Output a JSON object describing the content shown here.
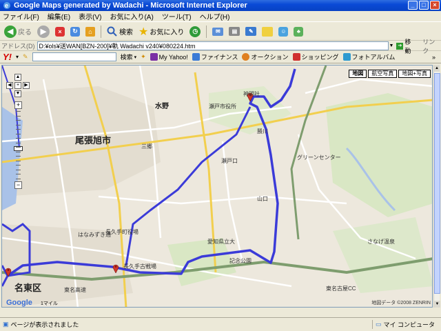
{
  "window": {
    "title": "Google Maps generated by Wadachi - Microsoft Internet Explorer",
    "minimize": "_",
    "maximize": "□",
    "close": "×"
  },
  "menu": [
    "ファイル(F)",
    "編集(E)",
    "表示(V)",
    "お気に入り(A)",
    "ツール(T)",
    "ヘルプ(H)"
  ],
  "toolbar": {
    "back_label": "戻る",
    "search_label": "検索",
    "favorites_label": "お気に入り"
  },
  "address": {
    "label": "アドレス(D)",
    "value": "D:¥ols¥送WAN[BZN-200]¥軌 Wadachi v240¥080224.htm",
    "go_label": "移動",
    "links_label": "リンク"
  },
  "yahoo": {
    "logo": "Y!",
    "search_label": "検索",
    "items": [
      "My Yahoo!",
      "ファイナンス",
      "オークション",
      "ショッピング",
      "フォトアルバム"
    ]
  },
  "map": {
    "types": [
      "地図",
      "航空写真",
      "地図+写真"
    ],
    "active_type": "地図",
    "copyright": "地図データ ©2008 ZENRIN",
    "scale": "1マイル",
    "logo": "Google",
    "zoom_level_fraction": 0.55,
    "labels": {
      "owariasahi": "尾張旭市",
      "meito": "名東区",
      "mizuno": "水野",
      "seto": "瀬戸口",
      "yamaguchi": "山口",
      "greencenter": "グリーンセンター",
      "nagakute": "長久手古戦場",
      "shoutaku": "瀬戸市役所",
      "asahi_station": "三郷",
      "hanamizuki": "はなみずき通",
      "ai_park": "愛知県立大",
      "kouen": "記念公園",
      "higashi": "東名古屋CC",
      "sanage": "さなげ温泉",
      "tomei": "東名高速",
      "ipark": "長久手町役場",
      "shokken": "勝川",
      "kaisho": "神明社"
    }
  },
  "status": {
    "text": "ページが表示されました",
    "zone": "マイ コンピュータ"
  },
  "colors": {
    "route": "#3b3bd8",
    "xp_title": "#0a4ad6",
    "map_bg": "#ede8dd",
    "marker": "#d0362a"
  }
}
